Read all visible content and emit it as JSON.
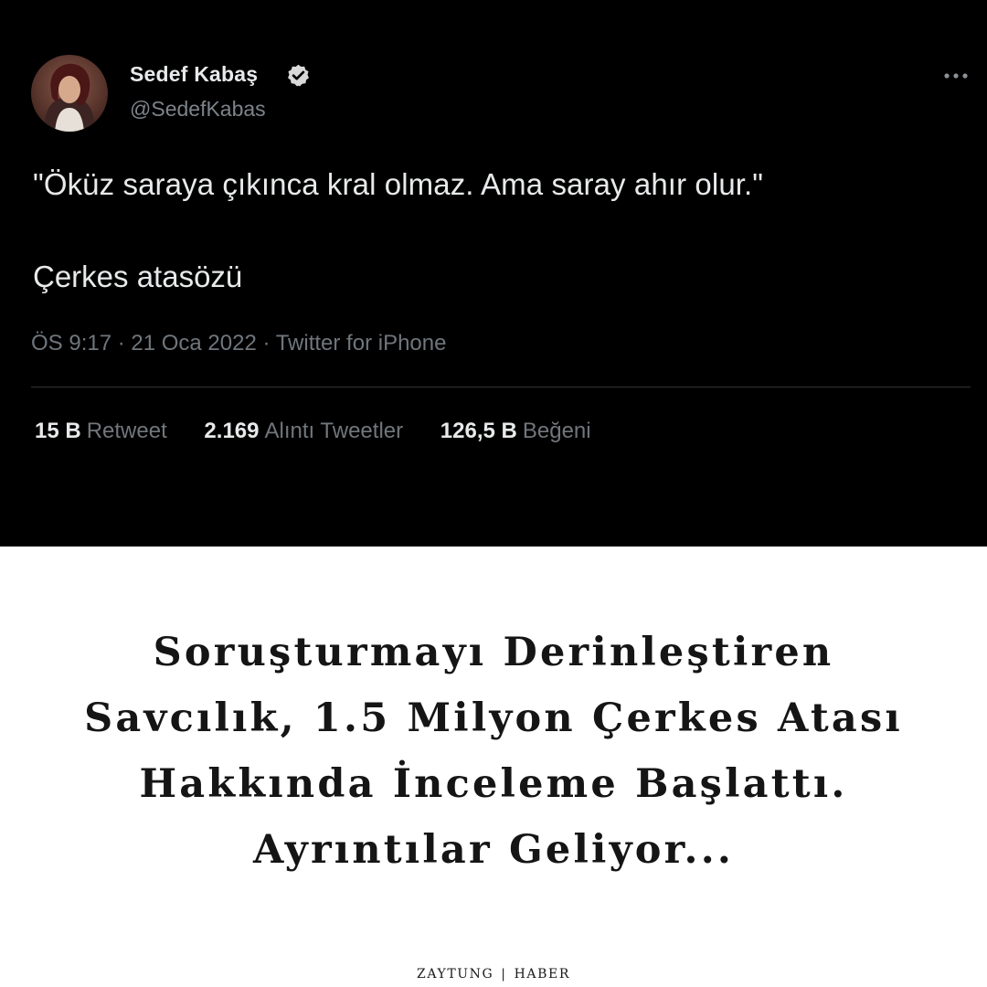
{
  "tweet": {
    "display_name": "Sedef Kabaş",
    "handle": "@SedefKabas",
    "text_line_1": "\"Öküz saraya çıkınca kral olmaz. Ama saray ahır olur.\"",
    "text_line_2": "Çerkes atasözü",
    "meta": "ÖS 9:17 · 21 Oca 2022 · Twitter for iPhone",
    "stats": [
      {
        "value": "15 B",
        "label": "Retweet"
      },
      {
        "value": "2.169",
        "label": "Alıntı Tweetler"
      },
      {
        "value": "126,5 B",
        "label": "Beğeni"
      }
    ],
    "icons": {
      "verified": "verified-badge-icon",
      "more": "more-options-icon"
    },
    "colors": {
      "background": "#000000",
      "text": "#e7e9ea",
      "muted": "#71767b"
    }
  },
  "headline": {
    "lines": [
      "Soruşturmayı Derinleştiren",
      "Savcılık, 1.5 Milyon Çerkes Atası",
      "Hakkında İnceleme Başlattı.",
      "Ayrıntılar Geliyor..."
    ]
  },
  "footer": {
    "brand": "ZAYTUNG",
    "separator": "|",
    "section": "HABER"
  }
}
